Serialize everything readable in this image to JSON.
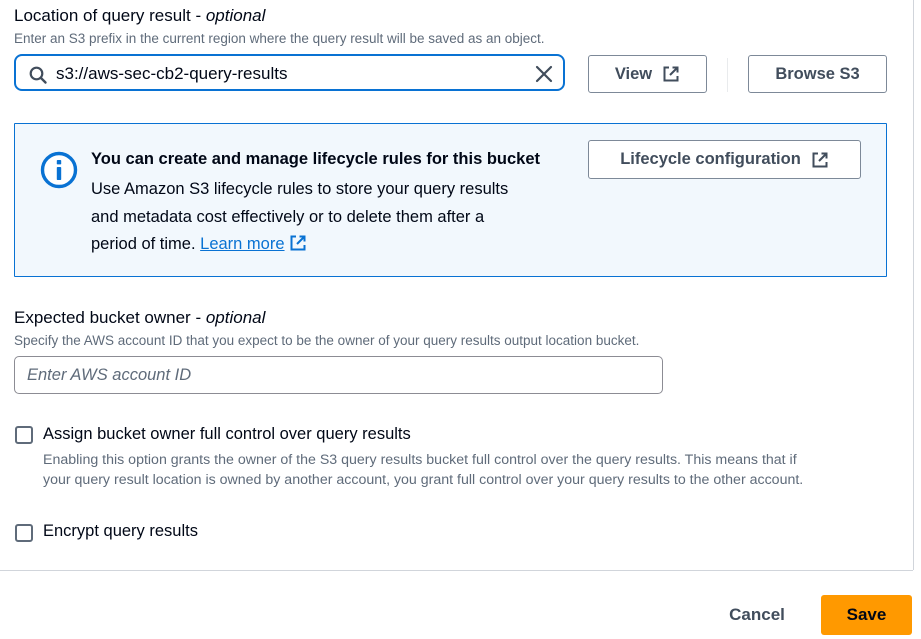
{
  "query_result_location": {
    "label": "Location of query result - ",
    "optional": "optional",
    "description": "Enter an S3 prefix in the current region where the query result will be saved as an object.",
    "value": "s3://aws-sec-cb2-query-results",
    "view_label": "View",
    "browse_label": "Browse S3"
  },
  "info_panel": {
    "title": "You can create and manage lifecycle rules for this bucket",
    "body_lines": [
      "Use Amazon S3 lifecycle rules to store your query results",
      "and metadata cost effectively or to delete them after a",
      "period of time. "
    ],
    "learn_more": "Learn more",
    "lifecycle_button": "Lifecycle configuration"
  },
  "expected_owner": {
    "label": "Expected bucket owner - ",
    "optional": "optional",
    "description": "Specify the AWS account ID that you expect to be the owner of your query results output location bucket.",
    "placeholder": "Enter AWS account ID"
  },
  "assign_control": {
    "label": "Assign bucket owner full control over query results",
    "description_lines": [
      "Enabling this option grants the owner of the S3 query results bucket full control over the query results. This means that if",
      "your query result location is owned by another account, you grant full control over your query results to the other account."
    ],
    "checked": false
  },
  "encrypt": {
    "label": "Encrypt query results",
    "checked": false
  },
  "footer": {
    "cancel_label": "Cancel",
    "save_label": "Save"
  },
  "colors": {
    "accent": "#0972d3",
    "primary_button": "#ff9900",
    "info_background": "#f2f8fd"
  },
  "icons": [
    "search-icon",
    "clear-icon",
    "external-link-icon",
    "info-icon"
  ]
}
